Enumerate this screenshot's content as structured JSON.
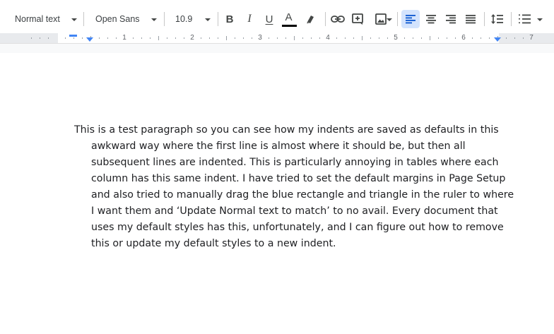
{
  "toolbar": {
    "style_select": "Normal text",
    "font_select": "Open Sans",
    "font_size": "10.9",
    "bold_label": "B",
    "italic_label": "I",
    "underline_label": "U",
    "text_color_label": "A",
    "text_color": "#000000",
    "accent_color": "#4285f4",
    "icons": [
      "bold-icon",
      "italic-icon",
      "underline-icon",
      "text-color-icon",
      "highlight-icon",
      "link-icon",
      "comment-icon",
      "image-icon",
      "align-left-icon",
      "align-center-icon",
      "align-right-icon",
      "justify-icon",
      "line-spacing-icon",
      "numbered-list-icon"
    ],
    "active_alignment": "left"
  },
  "ruler": {
    "numbers": [
      "1",
      "2",
      "3",
      "4",
      "5",
      "6",
      "7"
    ]
  },
  "document": {
    "paragraph_lines": [
      "This is a test paragraph so you can see how my indents are saved as defaults in this",
      "awkward way where the first line is almost where it should be, but then all",
      "subsequent lines are indented. This is particularly annoying in tables where each",
      "column has this same indent. I have tried to set the default margins in Page Setup",
      "and also tried to manually drag the blue rectangle and triangle in the ruler to where",
      "I want them and ‘Update Normal text to match’ to no avail. Every document that",
      "uses my default styles has this, unfortunately, and I can figure out how to remove",
      "this or update my default styles to a new indent."
    ]
  }
}
